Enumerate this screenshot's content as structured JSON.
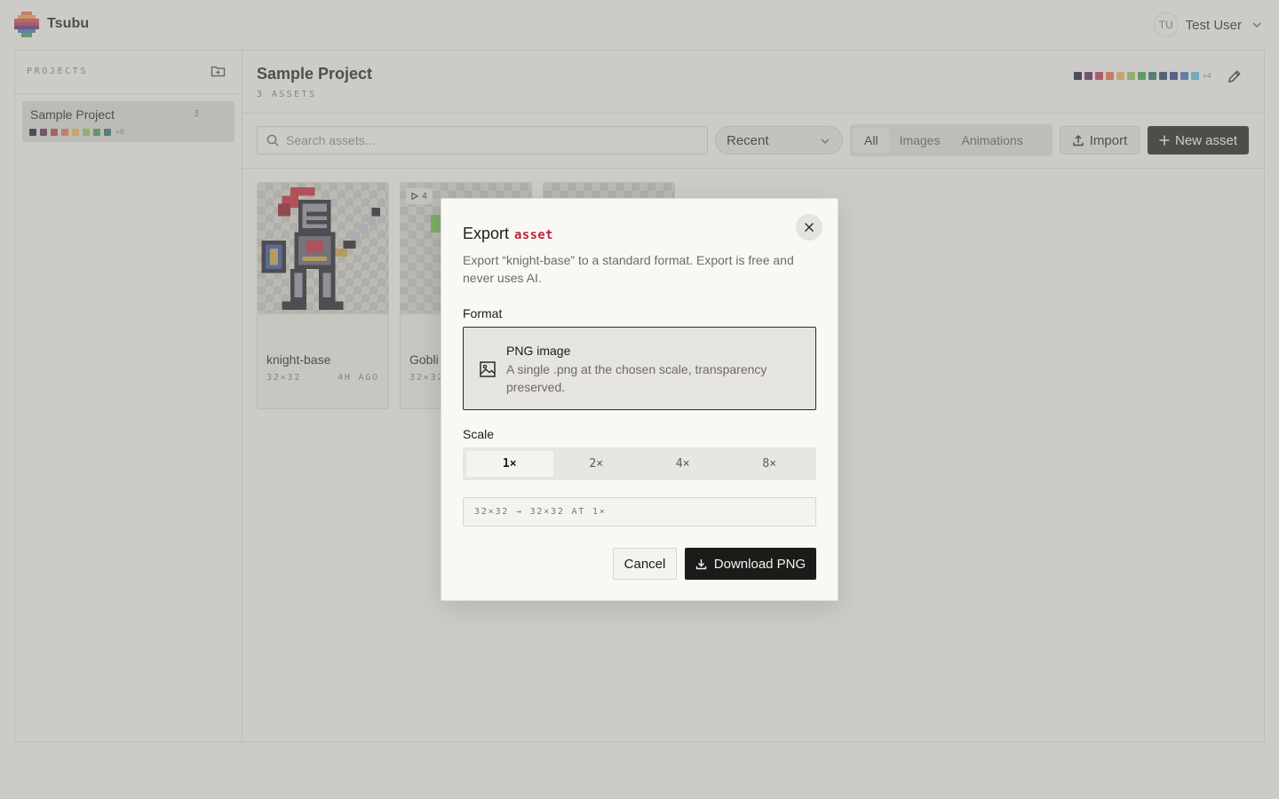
{
  "app": {
    "name": "Tsubu"
  },
  "user": {
    "initials": "TU",
    "name": "Test User"
  },
  "sidebar": {
    "title": "PROJECTS",
    "projects": [
      {
        "name": "Sample Project",
        "count": "3",
        "swatches": [
          "#1b1a33",
          "#5a2360",
          "#b23a55",
          "#e0704a",
          "#e8b45a",
          "#8dc256",
          "#3f9a4f",
          "#2b6c68"
        ],
        "more": "+8"
      }
    ]
  },
  "project": {
    "title": "Sample Project",
    "subtitle": "3 ASSETS",
    "palette": [
      "#1b1a33",
      "#5a2360",
      "#b23a55",
      "#e0704a",
      "#e8b45a",
      "#8dc256",
      "#3f9a4f",
      "#2b6c68",
      "#27415f",
      "#2e3e8c",
      "#3f6fc0",
      "#5bb8d6"
    ],
    "palette_more": "+4"
  },
  "toolbar": {
    "search_placeholder": "Search assets...",
    "sort": "Recent",
    "filters": [
      "All",
      "Images",
      "Animations"
    ],
    "active_filter": "All",
    "import_label": "Import",
    "new_label": "New asset"
  },
  "assets": [
    {
      "name": "knight-base",
      "size": "32×32",
      "time": "4H AGO"
    },
    {
      "name": "Gobli",
      "size": "32×32",
      "frames": "4"
    },
    {
      "name": ""
    }
  ],
  "modal": {
    "title": "Export",
    "title_accent": "asset",
    "description": "Export “knight-base” to a standard format. Export is free and never uses AI.",
    "format_label": "Format",
    "format": {
      "name": "PNG image",
      "description": "A single .png at the chosen scale, transparency preserved.",
      "icon": "image-icon"
    },
    "scale_label": "Scale",
    "scales": [
      "1×",
      "2×",
      "4×",
      "8×"
    ],
    "active_scale": "1×",
    "dims": "32×32 → 32×32 AT 1×",
    "cancel_label": "Cancel",
    "download_label": "Download PNG"
  },
  "colors": {
    "accent": "#c0263b",
    "primary_button": "#1c1b19",
    "background": "#f4f3ef"
  }
}
